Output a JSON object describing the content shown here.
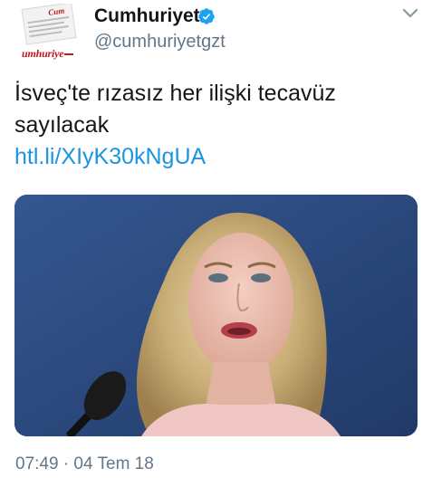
{
  "tweet": {
    "author": {
      "display_name": "Cumhuriyet",
      "handle": "@cumhuriyetgzt",
      "avatar_icon": "newspaper-logo",
      "avatar_text": "umhuriye",
      "verified_icon": "verified-badge-icon"
    },
    "text": "İsveç'te rızasız her ilişki tecavüz sayılacak",
    "link": "htl.li/XIyK30kNgUA",
    "media": {
      "type": "photo",
      "description_icon": "photo"
    },
    "timestamp": "07:49 · 04 Tem 18",
    "menu_icon": "chevron-down-icon"
  },
  "colors": {
    "text_primary": "#14171a",
    "text_secondary": "#657786",
    "link": "#1b95e0",
    "verified": "#1da1f2",
    "brand_red": "#c0161c"
  }
}
